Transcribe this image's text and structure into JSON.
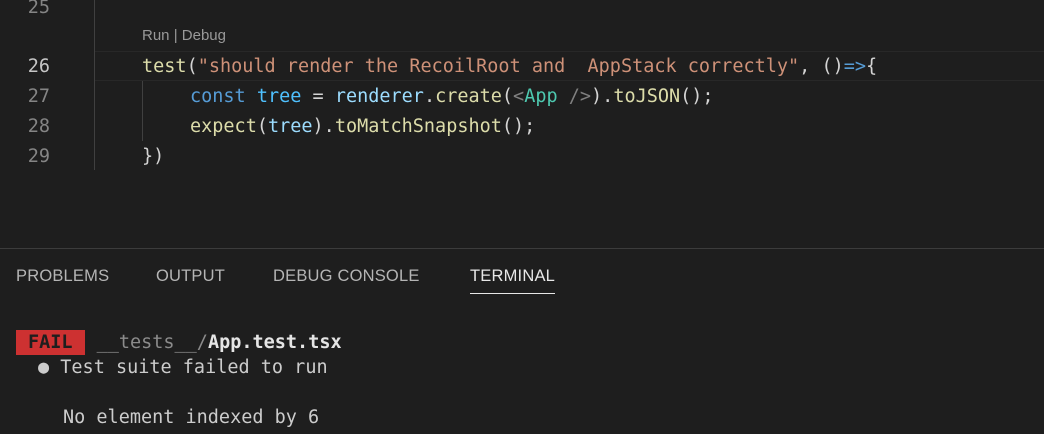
{
  "editor": {
    "line_numbers": [
      "25",
      "26",
      "27",
      "28",
      "29"
    ],
    "active_line": "26",
    "codelens": {
      "run": "Run",
      "separator": " | ",
      "debug": "Debug"
    },
    "lines": {
      "l26": {
        "fn": "test",
        "open": "(",
        "string": "\"should render the RecoilRoot and  AppStack correctly\"",
        "comma": ", ",
        "parens": "()",
        "arrow": "=>",
        "brace": "{"
      },
      "l27": {
        "kw": "const",
        "sp1": " ",
        "var": "tree",
        "eq": " = ",
        "obj": "renderer",
        "dot": ".",
        "method": "create",
        "open": "(",
        "lt": "<",
        "tag": "App",
        "close_tag": " />",
        "close": ")",
        "dot2": ".",
        "method2": "toJSON",
        "end": "();"
      },
      "l28": {
        "fn": "expect",
        "open": "(",
        "var": "tree",
        "close": ")",
        "dot": ".",
        "method": "toMatchSnapshot",
        "end": "();"
      },
      "l29": {
        "text": "})"
      }
    }
  },
  "panel": {
    "tabs": [
      "PROBLEMS",
      "OUTPUT",
      "DEBUG CONSOLE",
      "TERMINAL"
    ],
    "active_tab": "TERMINAL",
    "terminal": {
      "badge": "FAIL",
      "path_dim": "__tests__/",
      "path_file": "App.test.tsx",
      "bullet": "●",
      "suite_msg": "Test suite failed to run",
      "error_msg": "No element indexed by 6"
    }
  },
  "colors": {
    "background": "#1e1e1e",
    "fail_badge": "#cd3131",
    "string": "#ce9178",
    "function": "#dcdcaa",
    "keyword": "#569cd6",
    "variable": "#9cdcfe",
    "tag": "#4ec9b0"
  }
}
